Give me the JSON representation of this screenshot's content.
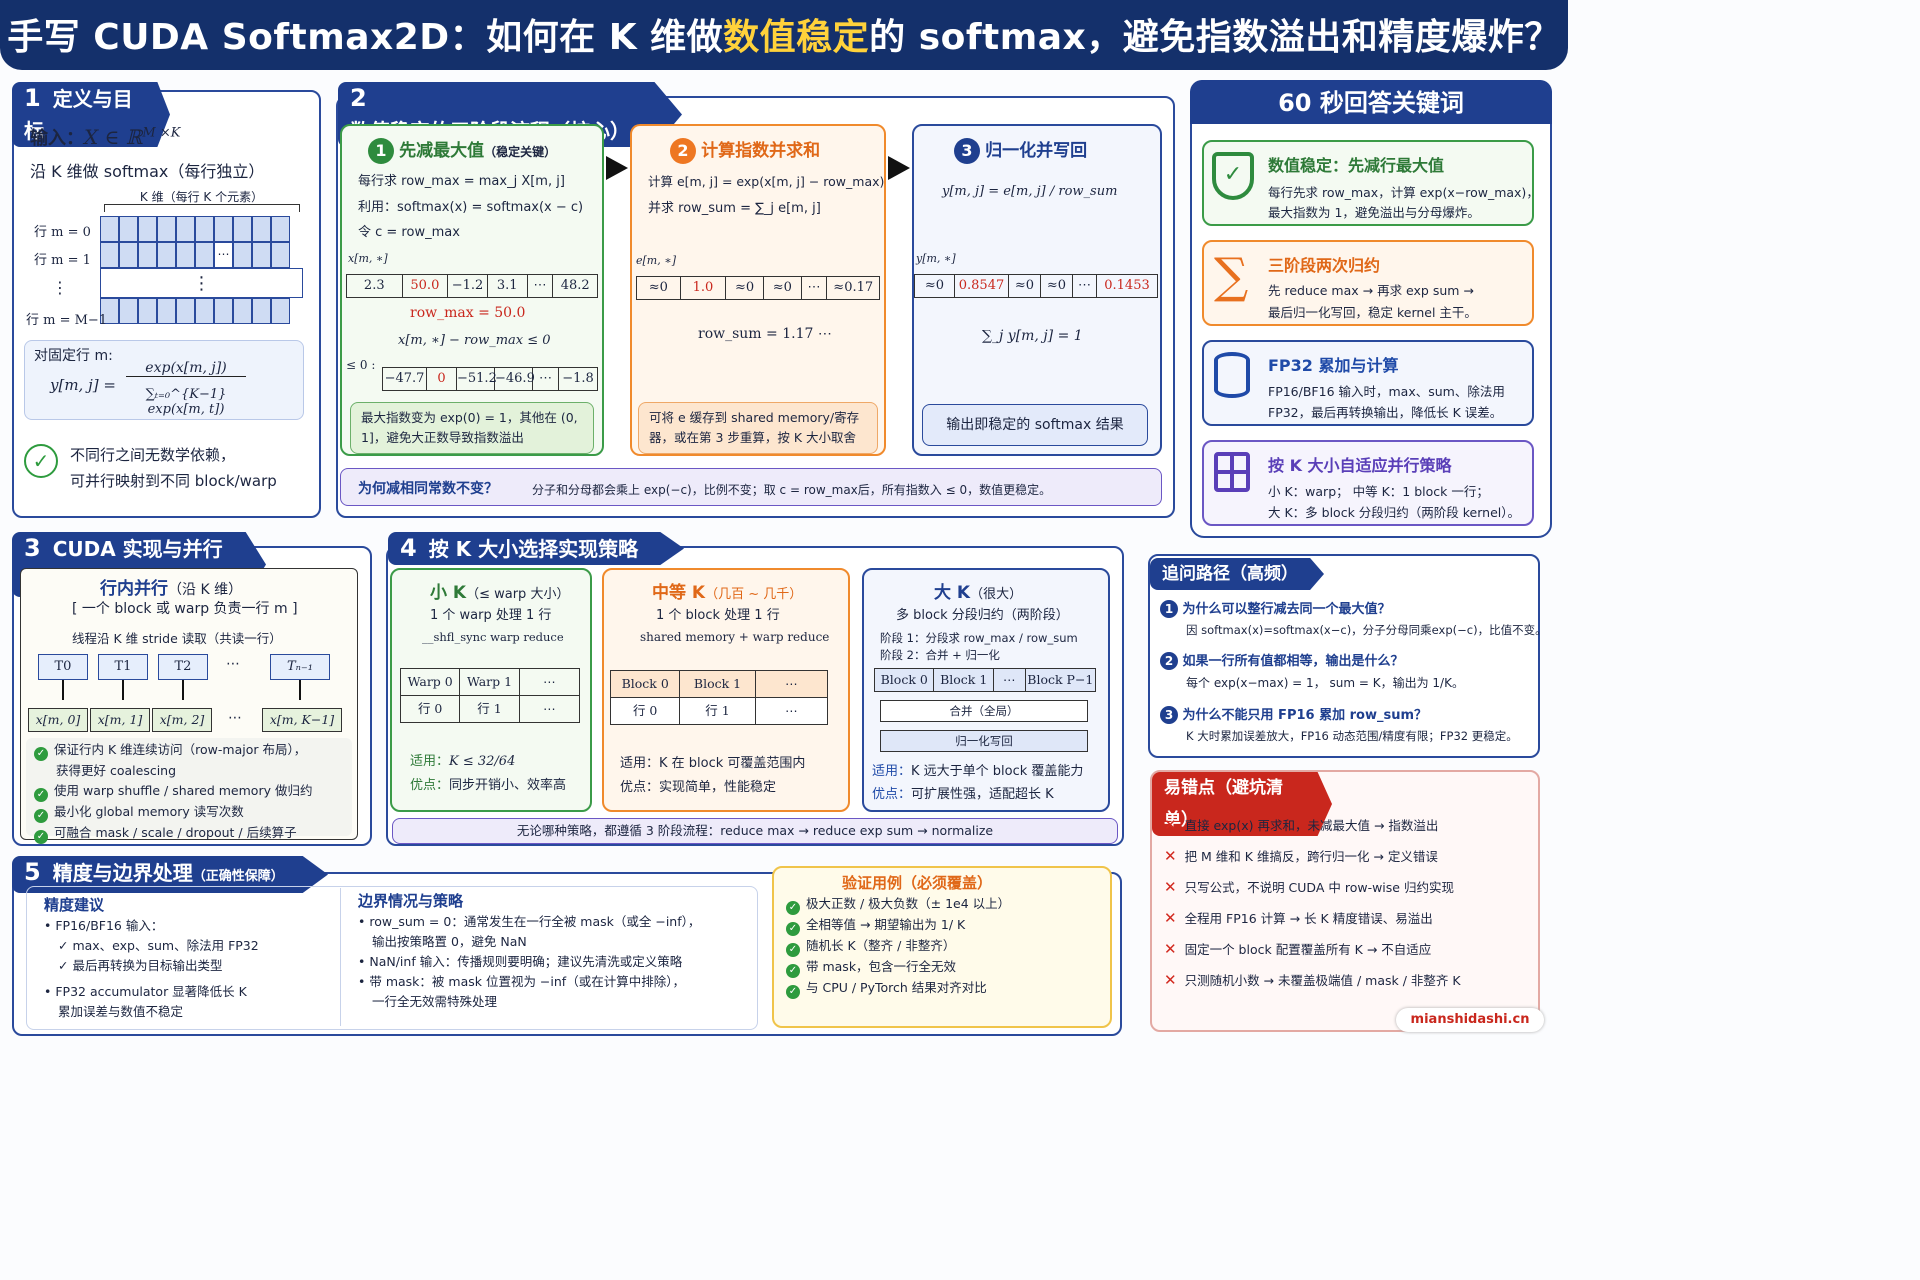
{
  "header": {
    "title_pre": "手写 CUDA Softmax2D：如何在 K 维做",
    "title_hl": "数值稳定",
    "title_post": "的 softmax，避免指数溢出和精度爆炸？"
  },
  "s1": {
    "num": "1",
    "title": "定义与目标",
    "input_label": "输入：",
    "input_math": "X ∈ ℝ^{M×K}",
    "along": "沿 K 维做 softmax（每行独立）",
    "kdim": "K 维（每行 K 个元素）",
    "rows": [
      "行 m = 0",
      "行 m = 1",
      "⋮",
      "行 m = M−1"
    ],
    "dots": "⋯",
    "vdots": "⋮",
    "fixed": "对固定行 m:",
    "formula_lhs": "y[m, j] =",
    "formula_num": "exp(x[m, j])",
    "formula_den": "∑ₜ₌₀^{K−1} exp(x[m, t])",
    "ind1": "不同行之间无数学依赖，",
    "ind2": "可并行映射到不同 block/warp"
  },
  "s2": {
    "num": "2",
    "title": "数值稳定的三阶段流程（核心）",
    "st1": {
      "n": "1",
      "title": "先减最大值",
      "sub": "（稳定关键）",
      "l1": "每行求 row_max = max_j X[m, j]",
      "l2": "利用：softmax(x) = softmax(x − c)",
      "l3": "令  c = row_max",
      "lab": "x[m, ∗]",
      "cells": [
        "2.3",
        "50.0",
        "−1.2",
        "3.1",
        "⋯",
        "48.2"
      ],
      "rowmax": "row_max = 50.0",
      "diff": "x[m, ∗] − row_max ≤ 0",
      "le": "≤ 0 :",
      "cells2": [
        "−47.7",
        "0",
        "−51.2",
        "−46.9",
        "⋯",
        "−1.8"
      ],
      "note": "最大指数变为 exp(0) = 1，其他在 (0, 1]，避免大正数导致指数溢出"
    },
    "st2": {
      "n": "2",
      "title": "计算指数并求和",
      "l1": "计算 e[m, j] = exp(x[m, j] − row_max)",
      "l2": "并求  row_sum = ∑_j e[m, j]",
      "lab": "e[m, ∗]",
      "cells": [
        "≈0",
        "1.0",
        "≈0",
        "≈0",
        "⋯",
        "≈0.17"
      ],
      "rowsum": "row_sum = 1.17 ⋯",
      "note": "可将 e 缓存到 shared memory/寄存器，或在第 3 步重算，按 K 大小取舍"
    },
    "st3": {
      "n": "3",
      "title": "归一化并写回",
      "l1": "y[m, j] = e[m, j] / row_sum",
      "lab": "y[m, ∗]",
      "cells": [
        "≈0",
        "0.8547",
        "≈0",
        "≈0",
        "⋯",
        "0.1453"
      ],
      "sum": "∑_j y[m, j] = 1",
      "note": "输出即稳定的 softmax 结果"
    },
    "why_q": "为何减相同常数不变？",
    "why_a": "分子和分母都会乘上 exp(−c)，比例不变；取 c = row_max后，所有指数入 ≤ 0，数值更稳定。"
  },
  "kw": {
    "title": "60 秒回答关键词",
    "items": [
      {
        "icon": "shield-check-icon",
        "title": "数值稳定：先减行最大值",
        "t1": "每行先求 row_max，计算 exp(x−row_max)，",
        "t2": "最大指数为 1，避免溢出与分母爆炸。",
        "color": "#2e8b3e"
      },
      {
        "icon": "sigma-icon",
        "title": "三阶段两次归约",
        "t1": "先 reduce max → 再求 exp sum →",
        "t2": "最后归一化写回，稳定 kernel 主干。",
        "color": "#e8701e"
      },
      {
        "icon": "database-icon",
        "title": "FP32 累加与计算",
        "t1": "FP16/BF16 输入时，max、sum、除法用",
        "t2": "FP32，最后再转换输出，降低长 K 误差。",
        "color": "#1f4aa8"
      },
      {
        "icon": "grid-icon",
        "title": "按 K 大小自适应并行策略",
        "t1": "小 K：warp；  中等 K：1 block 一行；",
        "t2": "大 K：多 block 分段归约（两阶段 kernel）。",
        "color": "#5a3fb8"
      }
    ]
  },
  "s3": {
    "num": "3",
    "title": "CUDA 实现与并行映射",
    "t1": "行内并行",
    "t1b": "（沿 K 维）",
    "t2": "[ 一个 block 或 warp 负责一行 m ]",
    "t3": "线程沿 K 维 stride 读取（共读一行）",
    "threads": [
      "T0",
      "T1",
      "T2",
      "⋯",
      "Tₙ₋₁"
    ],
    "xs": [
      "x[m, 0]",
      "x[m, 1]",
      "x[m, 2]",
      "⋯",
      "x[m, K−1]"
    ],
    "bul": [
      "保证行内 K 维连续访问（row-major 布局），",
      "获得更好 coalescing",
      "使用 warp shuffle / shared memory 做归约",
      "最小化 global memory 读写次数",
      "可融合 mask / scale / dropout / 后续算子"
    ]
  },
  "s4": {
    "num": "4",
    "title": "按 K 大小选择实现策略",
    "small": {
      "title": "小 K",
      "sub": "（≤ warp 大小）",
      "l1": "1 个 warp 处理 1 行",
      "l2": "__shfl_sync warp reduce",
      "h": [
        "Warp 0",
        "Warp 1",
        "⋯"
      ],
      "r": [
        "行 0",
        "行 1",
        "⋯"
      ],
      "use_k": "适用：",
      "use_v": "K ≤ 32/64",
      "adv_k": "优点：",
      "adv_v": "同步开销小、效率高"
    },
    "mid": {
      "title": "中等 K",
      "sub": "（几百 ~ 几千）",
      "l1": "1 个 block 处理 1 行",
      "l2": "shared memory + warp reduce",
      "h": [
        "Block 0",
        "Block 1",
        "⋯"
      ],
      "r": [
        "行 0",
        "行 1",
        "⋯"
      ],
      "use_k": "适用：",
      "use_v": "K 在 block 可覆盖范围内",
      "adv_k": "优点：",
      "adv_v": "实现简单，性能稳定"
    },
    "big": {
      "title": "大 K",
      "sub": "（很大）",
      "l1": "多 block 分段归约（两阶段）",
      "l2": "阶段 1：分段求  row_max / row_sum",
      "l3": "阶段 2：合并 + 归一化",
      "h": [
        "Block 0",
        "Block 1",
        "⋯",
        "Block P−1"
      ],
      "merge": "合并（全局）",
      "norm": "归一化写回",
      "use_k": "适用：",
      "use_v": "K 远大于单个 block 覆盖能力",
      "adv_k": "优点：",
      "adv_v": "可扩展性强，适配超长 K"
    },
    "foot": "无论哪种策略，都遵循 3 阶段流程：reduce max  →  reduce exp sum  →  normalize"
  },
  "s5": {
    "num": "5",
    "title": "精度与边界处理",
    "sub": "（正确性保障）",
    "prec": {
      "title": "精度建议",
      "b1": "FP16/BF16 输入：",
      "c1": "max、exp、sum、除法用 FP32",
      "c2": "最后再转换为目标输出类型",
      "b2": "FP32 accumulator 显著降低长 K",
      "b2b": "累加误差与数值不稳定"
    },
    "edge": {
      "title": "边界情况与策略",
      "b1": "row_sum = 0：通常发生在一行全被 mask（或全 −inf），",
      "b1b": "输出按策略置 0，避免 NaN",
      "b2": "NaN/inf 输入：传播规则要明确；建议先清洗或定义策略",
      "b3": "带 mask：被 mask 位置视为 −inf（或在计算中排除），",
      "b3b": "一行全无效需特殊处理"
    },
    "test": {
      "title": "验证用例（必须覆盖）",
      "items": [
        "极大正数 / 极大负数（± 1e4 以上）",
        "全相等值 → 期望输出为 1/ K",
        "随机长 K（整齐 / 非整齐）",
        "带 mask，包含一行全无效",
        "与 CPU / PyTorch 结果对齐对比"
      ]
    }
  },
  "follow": {
    "title": "追问路径（高频）",
    "items": [
      {
        "n": "1",
        "q": "为什么可以整行减去同一个最大值？",
        "a": "因 softmax(x)=softmax(x−c)，分子分母同乘exp(−c)，比值不变。"
      },
      {
        "n": "2",
        "q": "如果一行所有值都相等，输出是什么？",
        "a": "每个 exp(x−max) = 1，  sum = K，输出为 1/K。"
      },
      {
        "n": "3",
        "q": "为什么不能只用 FP16 累加 row_sum？",
        "a": "K 大时累加误差放大，FP16 动态范围/精度有限；FP32 更稳定。"
      }
    ]
  },
  "pit": {
    "title": "易错点（避坑清单）",
    "items": [
      "直接 exp(x) 再求和，未减最大值 → 指数溢出",
      "把 M 维和 K 维搞反，跨行归一化 → 定义错误",
      "只写公式，不说明 CUDA 中 row-wise 归约实现",
      "全程用 FP16 计算 → 长 K 精度错误、易溢出",
      "固定一个 block 配置覆盖所有 K → 不自适应",
      "只测随机小数 → 未覆盖极端值 / mask / 非整齐 K"
    ]
  },
  "watermark": "mianshidashi.cn",
  "colors": {
    "navy": "#14306b",
    "green": "#3b9b48",
    "orange": "#f08a2c",
    "purple": "#6b57c4",
    "red": "#c9271d"
  }
}
